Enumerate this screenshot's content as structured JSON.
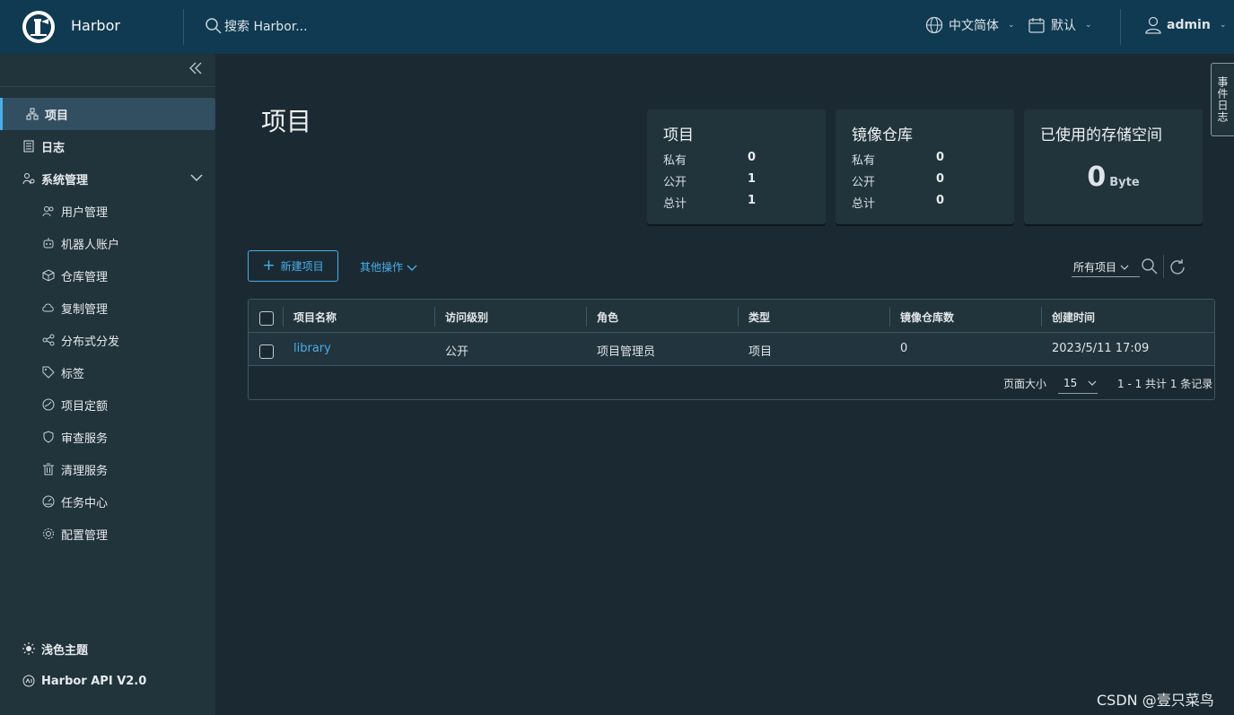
{
  "header": {
    "brand": "Harbor",
    "search_placeholder": "搜索 Harbor...",
    "language": "中文简体",
    "datetime_format": "默认",
    "user": "admin"
  },
  "sidebar": {
    "items": [
      {
        "label": "项目",
        "icon": "projects-icon"
      },
      {
        "label": "日志",
        "icon": "logs-icon"
      },
      {
        "label": "系统管理",
        "icon": "admin-icon"
      }
    ],
    "admin_items": [
      {
        "label": "用户管理",
        "icon": "users-icon"
      },
      {
        "label": "机器人账户",
        "icon": "robot-icon"
      },
      {
        "label": "仓库管理",
        "icon": "registry-icon"
      },
      {
        "label": "复制管理",
        "icon": "replication-icon"
      },
      {
        "label": "分布式分发",
        "icon": "distribution-icon"
      },
      {
        "label": "标签",
        "icon": "tag-icon"
      },
      {
        "label": "项目定额",
        "icon": "quota-icon"
      },
      {
        "label": "审查服务",
        "icon": "shield-icon"
      },
      {
        "label": "清理服务",
        "icon": "trash-icon"
      },
      {
        "label": "任务中心",
        "icon": "dashboard-icon"
      },
      {
        "label": "配置管理",
        "icon": "gear-icon"
      }
    ],
    "theme_label": "浅色主题",
    "api_label": "Harbor API V2.0"
  },
  "main": {
    "title": "项目",
    "cards": {
      "projects": {
        "title": "项目",
        "private_label": "私有",
        "private": "0",
        "public_label": "公开",
        "public": "1",
        "total_label": "总计",
        "total": "1"
      },
      "repos": {
        "title": "镜像仓库",
        "private_label": "私有",
        "private": "0",
        "public_label": "公开",
        "public": "0",
        "total_label": "总计",
        "total": "0"
      },
      "storage": {
        "title": "已使用的存储空间",
        "value": "0",
        "unit": "Byte"
      }
    },
    "toolbar": {
      "new_project": "新建项目",
      "more_actions": "其他操作",
      "filter": "所有项目"
    },
    "table": {
      "columns": [
        "项目名称",
        "访问级别",
        "角色",
        "类型",
        "镜像仓库数",
        "创建时间"
      ],
      "rows": [
        {
          "name": "library",
          "access": "公开",
          "role": "项目管理员",
          "type": "项目",
          "repo_count": "0",
          "created": "2023/5/11 17:09"
        }
      ],
      "page_size_label": "页面大小",
      "page_size": "15",
      "summary": "1 - 1 共计 1 条记录"
    }
  },
  "drawer_tab": "事件日志",
  "watermark": "CSDN @壹只菜鸟",
  "colors": {
    "accent": "#49aeea",
    "header": "#0f3a52",
    "sidebar": "#21333b",
    "background": "#1b2a32"
  }
}
